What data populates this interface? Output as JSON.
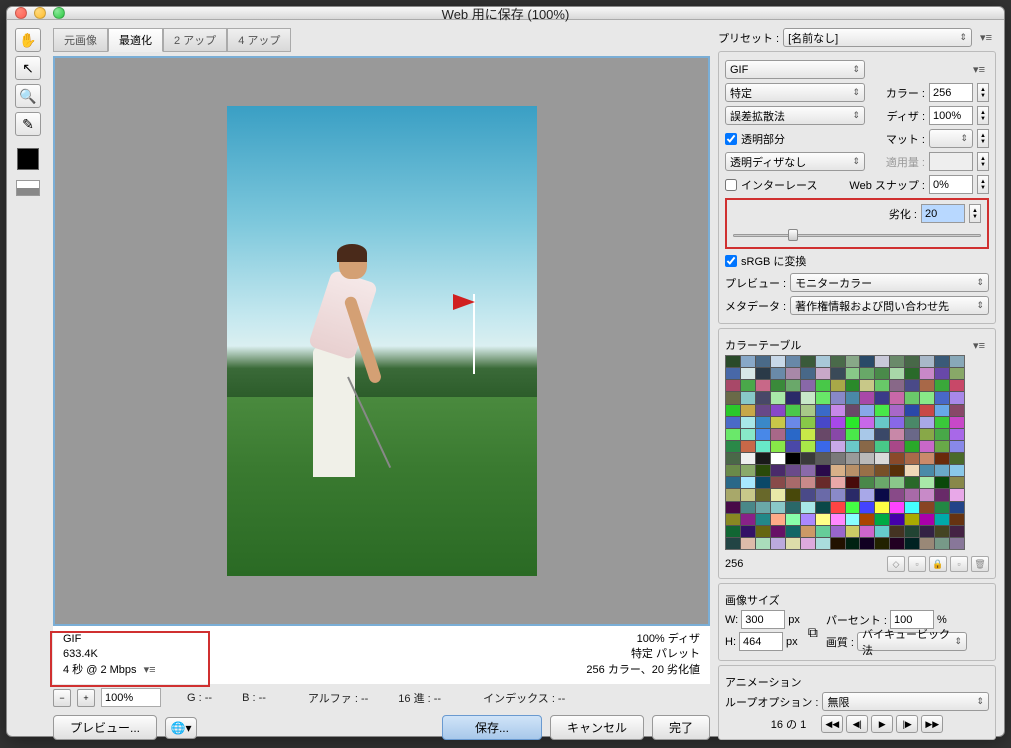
{
  "window": {
    "title": "Web 用に保存 (100%)"
  },
  "tabs": {
    "original": "元画像",
    "optimized": "最適化",
    "twoup": "2 アップ",
    "fourup": "4 アップ"
  },
  "info": {
    "format": "GIF",
    "size": "633.4K",
    "speed": "4 秒 @ 2 Mbps",
    "dither_line": "100% ディザ",
    "palette_line": "特定 パレット",
    "lossy_line": "256 カラー、20 劣化値"
  },
  "zoom": {
    "value": "100%",
    "r": "G : --",
    "g": "B : --",
    "alpha": "アルファ : --",
    "hex": "16 進 : --",
    "index": "インデックス : --"
  },
  "footer": {
    "preview": "プレビュー...",
    "save": "保存...",
    "cancel": "キャンセル",
    "done": "完了"
  },
  "preset": {
    "label": "プリセット :",
    "value": "[名前なし]"
  },
  "format": {
    "value": "GIF"
  },
  "reduction": {
    "value": "特定",
    "colors_label": "カラー :",
    "colors_value": "256"
  },
  "dither": {
    "method": "誤差拡散法",
    "label": "ディザ :",
    "value": "100%"
  },
  "transparency": {
    "checkbox": "透明部分",
    "matte_label": "マット :",
    "matte_value": ""
  },
  "trans_dither": {
    "value": "透明ディザなし",
    "amount_label": "適用量 :",
    "amount_value": ""
  },
  "interlace": {
    "checkbox": "インターレース",
    "snap_label": "Web スナップ :",
    "snap_value": "0%"
  },
  "lossy": {
    "label": "劣化 :",
    "value": "20"
  },
  "srgb": {
    "checkbox": "sRGB に変換"
  },
  "previewmode": {
    "label": "プレビュー :",
    "value": "モニターカラー"
  },
  "metadata": {
    "label": "メタデータ :",
    "value": "著作権情報および問い合わせ先"
  },
  "colortable": {
    "title": "カラーテーブル",
    "count": "256"
  },
  "imagesize": {
    "title": "画像サイズ",
    "w_label": "W:",
    "w_value": "300",
    "px": "px",
    "h_label": "H:",
    "h_value": "464",
    "percent_label": "パーセント :",
    "percent_value": "100",
    "percent_suffix": "%",
    "quality_label": "画質 :",
    "quality_value": "バイキュービック法"
  },
  "animation": {
    "title": "アニメーション",
    "loop_label": "ループオプション :",
    "loop_value": "無限",
    "frame": "16 の 1"
  },
  "ct_colors": [
    "#2a4a2a",
    "#88a8c8",
    "#4a6a88",
    "#c8d8e8",
    "#6888a8",
    "#3a5a3a",
    "#a8c8d8",
    "#4a6a4a",
    "#88a888",
    "#2a4a68",
    "#c8c8d8",
    "#6a8a6a",
    "#486848",
    "#a8b8c8",
    "#3a5a78",
    "#88a8b8",
    "#4868a8",
    "#d8e8e8",
    "#2a3a48",
    "#6a8aa8",
    "#a888a8",
    "#486888",
    "#c8a8c8",
    "#3a4a58",
    "#88c888",
    "#68a868",
    "#4a8a4a",
    "#a8d8a8",
    "#2a6a2a",
    "#c888c8",
    "#6848a8",
    "#88a868",
    "#a84868",
    "#4aa84a",
    "#c86888",
    "#3a8a3a",
    "#6aa86a",
    "#8868a8",
    "#48c848",
    "#a8a848",
    "#2a8a2a",
    "#c8c888",
    "#68c868",
    "#886888",
    "#4a4a88",
    "#a86848",
    "#3aa83a",
    "#c84868",
    "#6a6a48",
    "#88c8c8",
    "#484868",
    "#a8e8a8",
    "#2a2a68",
    "#c8e8c8",
    "#68e868",
    "#8888c8",
    "#4a88a8",
    "#a848a8",
    "#3a3a88",
    "#c868a8",
    "#6ac86a",
    "#88e888",
    "#4868c8",
    "#a888e8",
    "#2ac82a",
    "#c8a848",
    "#684888",
    "#8848c8",
    "#4ac84a",
    "#a8c888",
    "#3a6ac8",
    "#c888e8",
    "#6a4868",
    "#88a8e8",
    "#48e848",
    "#a868c8",
    "#2a48a8",
    "#c84848",
    "#68a8e8",
    "#884868",
    "#4a6ac8",
    "#a8e8e8",
    "#3a88c8",
    "#c8c848",
    "#6a88e8",
    "#88c848",
    "#4848c8",
    "#a848e8",
    "#2ae82a",
    "#c868e8",
    "#68c8c8",
    "#8868e8",
    "#4a8868",
    "#a8a8e8",
    "#3ac83a",
    "#c848c8",
    "#6ae86a",
    "#88e8c8",
    "#4888e8",
    "#a86888",
    "#2a68c8",
    "#c8e848",
    "#684868",
    "#8848a8",
    "#4ae84a",
    "#a8c8e8",
    "#3a4868",
    "#c888a8",
    "#6a6888",
    "#88a848",
    "#48a848",
    "#a868e8",
    "#2a8848",
    "#c86848",
    "#68e8c8",
    "#88e848",
    "#4a48a8",
    "#a8e848",
    "#3a68e8",
    "#c8a8e8",
    "#6ac8c8",
    "#886848",
    "#48c888",
    "#a84888",
    "#2aa82a",
    "#c868c8",
    "#68a848",
    "#8888e8",
    "#4a6848",
    "#efefef",
    "#1a1a1a",
    "#ffffff",
    "#000000",
    "#3a3a3a",
    "#5a5a5a",
    "#7a7a7a",
    "#9a9a9a",
    "#bababa",
    "#dadada",
    "#8a4a2a",
    "#aa6a4a",
    "#ca8a6a",
    "#6a2a0a",
    "#4a6a2a",
    "#6a8a4a",
    "#8aaa6a",
    "#2a4a0a",
    "#4a2a6a",
    "#6a4a8a",
    "#8a6aaa",
    "#2a0a4a",
    "#d8b088",
    "#b89068",
    "#987048",
    "#785028",
    "#583008",
    "#f0d8b8",
    "#4a8aa8",
    "#6aa8c8",
    "#8ac8e8",
    "#2a6888",
    "#a8e8ff",
    "#0a4868",
    "#884a4a",
    "#a86a6a",
    "#c88a8a",
    "#682a2a",
    "#e8a8a8",
    "#480a0a",
    "#4a884a",
    "#6aa86a",
    "#8ac88a",
    "#2a682a",
    "#a8e8a8",
    "#0a480a",
    "#88884a",
    "#a8a86a",
    "#c8c88a",
    "#68682a",
    "#e8e8a8",
    "#48480a",
    "#4a4a88",
    "#6a6aa8",
    "#8a8ac8",
    "#2a2a68",
    "#a8a8e8",
    "#0a0a48",
    "#884a88",
    "#a86aa8",
    "#c88ac8",
    "#682a68",
    "#e8a8e8",
    "#480a48",
    "#4a8888",
    "#6aa8a8",
    "#8ac8c8",
    "#2a6868",
    "#a8e8e8",
    "#0a4848",
    "#ff4444",
    "#44ff44",
    "#4444ff",
    "#ffff44",
    "#ff44ff",
    "#44ffff",
    "#884422",
    "#228844",
    "#224488",
    "#888822",
    "#882288",
    "#228888",
    "#ffaa88",
    "#88ffaa",
    "#aa88ff",
    "#ffff88",
    "#ff88ff",
    "#88ffff",
    "#aa4400",
    "#00aa44",
    "#4400aa",
    "#aaaa00",
    "#aa00aa",
    "#00aaaa",
    "#663311",
    "#116633",
    "#331166",
    "#666611",
    "#661166",
    "#116666",
    "#cc9966",
    "#66cc99",
    "#9966cc",
    "#cccc66",
    "#cc66cc",
    "#66cccc",
    "#443322",
    "#224433",
    "#332244",
    "#444422",
    "#442244",
    "#224444",
    "#ddbbaa",
    "#aaddbb",
    "#bbaadd",
    "#ddddaa",
    "#ddaadd",
    "#aadddd",
    "#221100",
    "#002211",
    "#110022",
    "#222200",
    "#220022",
    "#002222",
    "#998877",
    "#779988",
    "#887799",
    "#999977",
    "#997799",
    "#779999",
    "#554433",
    "#335544",
    "#443355",
    "#555533",
    "#553355",
    "#335555"
  ]
}
